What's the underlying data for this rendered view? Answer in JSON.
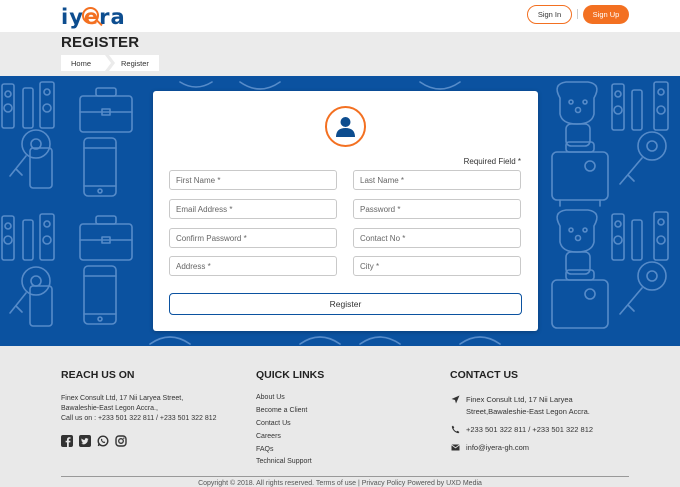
{
  "header": {
    "logo_text_pre": "iy",
    "logo_text_e": "e",
    "logo_text_post": "ra",
    "signin_label": "Sign In",
    "signup_label": "Sign Up"
  },
  "title_band": {
    "title": "REGISTER",
    "breadcrumb": [
      "Home",
      "Register"
    ]
  },
  "form": {
    "required_note": "Required Field *",
    "fields": {
      "first_name": "First Name *",
      "last_name": "Last Name *",
      "email": "Email Address *",
      "password": "Password *",
      "confirm_password": "Confirm Password *",
      "contact_no": "Contact No *",
      "address": "Address *",
      "city": "City *"
    },
    "submit_label": "Register"
  },
  "footer": {
    "reach": {
      "heading": "REACH US ON",
      "lines": [
        "Finex Consult Ltd, 17 Nii Laryea Street,",
        "Bawaleshie-East Legon Accra.,",
        "Call us on : +233 501 322 811 / +233 501 322 812"
      ],
      "social": [
        "facebook-icon",
        "twitter-icon",
        "whatsapp-icon",
        "instagram-icon"
      ]
    },
    "quick_links": {
      "heading": "QUICK LINKS",
      "items": [
        "About Us",
        "Become a Client",
        "Contact Us",
        "Careers",
        "FAQs",
        "Technical Support"
      ]
    },
    "contact": {
      "heading": "CONTACT US",
      "address_line1": "Finex Consult Ltd, 17 Nii Laryea",
      "address_line2": "Street,Bawaleshie-East Legon Accra.",
      "phones": "+233 501 322 811 / +233 501 322 812",
      "email": "info@iyera-gh.com"
    },
    "copyright": "Copyright © 2018. All rights reserved. Terms of use | Privacy Policy Powered by UXD Media"
  },
  "colors": {
    "brand_orange": "#f37021",
    "brand_blue": "#0b52a0",
    "logo_blue": "#0d4d8f"
  }
}
